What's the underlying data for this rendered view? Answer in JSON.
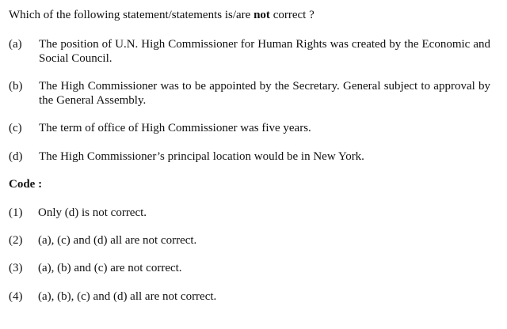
{
  "question": {
    "prefix": "Which of the following statement/statements is/are ",
    "emphasis": "not",
    "suffix": " correct ?"
  },
  "statements": [
    {
      "label": "(a)",
      "text": "The position of U.N. High Commissioner for Human Rights was created by the Economic and Social Council."
    },
    {
      "label": "(b)",
      "text": "The High Commissioner was to be appointed by the Secretary. General subject to approval by the General Assembly."
    },
    {
      "label": "(c)",
      "text": "The term of office of High Commissioner was five years."
    },
    {
      "label": "(d)",
      "text": "The High Commissioner’s principal location would be in New York."
    }
  ],
  "code_heading": "Code :",
  "options": [
    {
      "label": "(1)",
      "text": "Only (d) is not correct."
    },
    {
      "label": "(2)",
      "text": "(a), (c) and (d) all are not correct."
    },
    {
      "label": "(3)",
      "text": "(a), (b) and (c) are not correct."
    },
    {
      "label": "(4)",
      "text": "(a), (b), (c) and (d) all are not correct."
    }
  ]
}
